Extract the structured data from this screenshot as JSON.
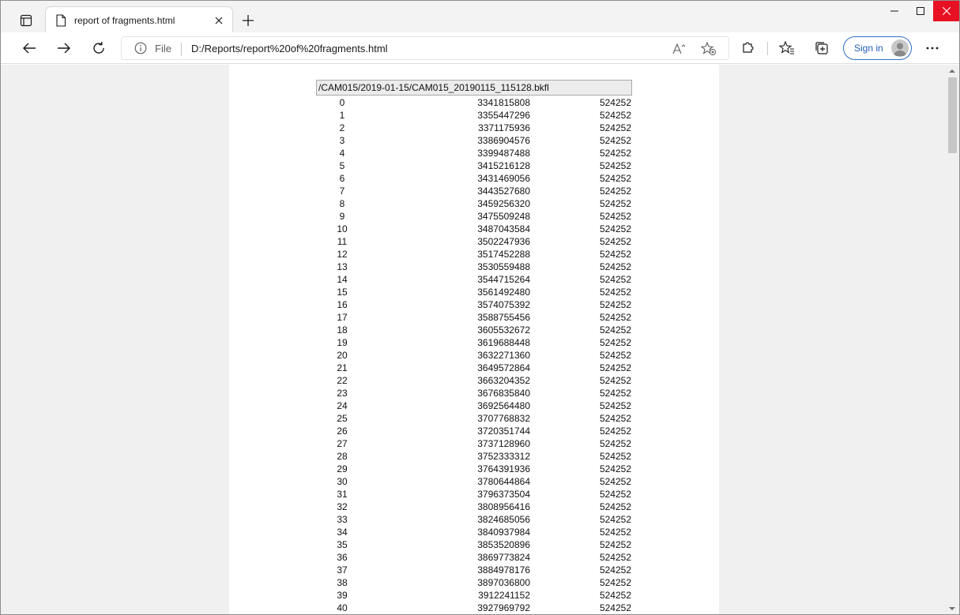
{
  "browser": {
    "tab": {
      "title": "report of fragments.html",
      "close_glyph": "✕"
    },
    "new_tab_glyph": "+",
    "window_controls": {
      "minimize": "—",
      "maximize": "☐",
      "close": "✕"
    },
    "address": {
      "scheme_label": "File",
      "url": "D:/Reports/report%20of%20fragments.html"
    },
    "sign_in_label": "Sign in",
    "more_glyph": "···"
  },
  "report": {
    "file_path": "/CAM015/2019-01-15/CAM015_20190115_115128.bkfl",
    "rows": [
      {
        "idx": "0",
        "offset": "3341815808",
        "size": "524252"
      },
      {
        "idx": "1",
        "offset": "3355447296",
        "size": "524252"
      },
      {
        "idx": "2",
        "offset": "3371175936",
        "size": "524252"
      },
      {
        "idx": "3",
        "offset": "3386904576",
        "size": "524252"
      },
      {
        "idx": "4",
        "offset": "3399487488",
        "size": "524252"
      },
      {
        "idx": "5",
        "offset": "3415216128",
        "size": "524252"
      },
      {
        "idx": "6",
        "offset": "3431469056",
        "size": "524252"
      },
      {
        "idx": "7",
        "offset": "3443527680",
        "size": "524252"
      },
      {
        "idx": "8",
        "offset": "3459256320",
        "size": "524252"
      },
      {
        "idx": "9",
        "offset": "3475509248",
        "size": "524252"
      },
      {
        "idx": "10",
        "offset": "3487043584",
        "size": "524252"
      },
      {
        "idx": "11",
        "offset": "3502247936",
        "size": "524252"
      },
      {
        "idx": "12",
        "offset": "3517452288",
        "size": "524252"
      },
      {
        "idx": "13",
        "offset": "3530559488",
        "size": "524252"
      },
      {
        "idx": "14",
        "offset": "3544715264",
        "size": "524252"
      },
      {
        "idx": "15",
        "offset": "3561492480",
        "size": "524252"
      },
      {
        "idx": "16",
        "offset": "3574075392",
        "size": "524252"
      },
      {
        "idx": "17",
        "offset": "3588755456",
        "size": "524252"
      },
      {
        "idx": "18",
        "offset": "3605532672",
        "size": "524252"
      },
      {
        "idx": "19",
        "offset": "3619688448",
        "size": "524252"
      },
      {
        "idx": "20",
        "offset": "3632271360",
        "size": "524252"
      },
      {
        "idx": "21",
        "offset": "3649572864",
        "size": "524252"
      },
      {
        "idx": "22",
        "offset": "3663204352",
        "size": "524252"
      },
      {
        "idx": "23",
        "offset": "3676835840",
        "size": "524252"
      },
      {
        "idx": "24",
        "offset": "3692564480",
        "size": "524252"
      },
      {
        "idx": "25",
        "offset": "3707768832",
        "size": "524252"
      },
      {
        "idx": "26",
        "offset": "3720351744",
        "size": "524252"
      },
      {
        "idx": "27",
        "offset": "3737128960",
        "size": "524252"
      },
      {
        "idx": "28",
        "offset": "3752333312",
        "size": "524252"
      },
      {
        "idx": "29",
        "offset": "3764391936",
        "size": "524252"
      },
      {
        "idx": "30",
        "offset": "3780644864",
        "size": "524252"
      },
      {
        "idx": "31",
        "offset": "3796373504",
        "size": "524252"
      },
      {
        "idx": "32",
        "offset": "3808956416",
        "size": "524252"
      },
      {
        "idx": "33",
        "offset": "3824685056",
        "size": "524252"
      },
      {
        "idx": "34",
        "offset": "3840937984",
        "size": "524252"
      },
      {
        "idx": "35",
        "offset": "3853520896",
        "size": "524252"
      },
      {
        "idx": "36",
        "offset": "3869773824",
        "size": "524252"
      },
      {
        "idx": "37",
        "offset": "3884978176",
        "size": "524252"
      },
      {
        "idx": "38",
        "offset": "3897036800",
        "size": "524252"
      },
      {
        "idx": "39",
        "offset": "3912241152",
        "size": "524252"
      },
      {
        "idx": "40",
        "offset": "3927969792",
        "size": "524252"
      }
    ]
  }
}
